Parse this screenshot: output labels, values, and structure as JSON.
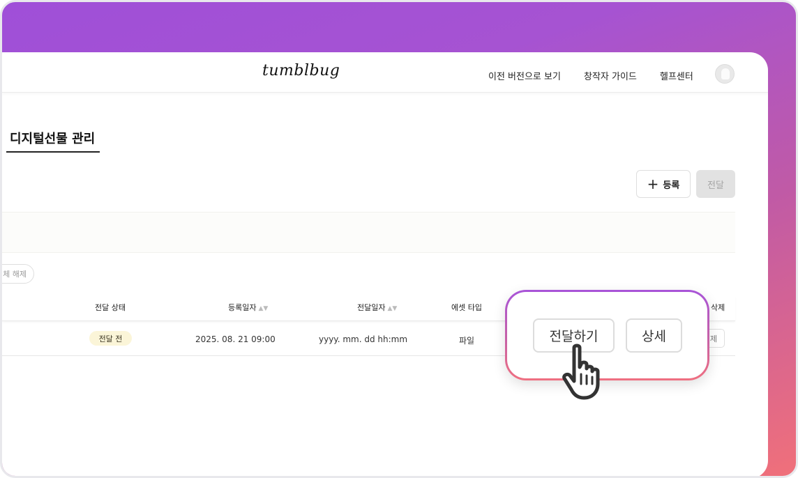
{
  "header": {
    "logo": "tumblbug",
    "nav": {
      "previous_version": "이전 버전으로 보기",
      "creator_guide": "창작자 가이드",
      "help_center": "헬프센터"
    }
  },
  "page": {
    "title": "디지털선물 관리"
  },
  "toolbar": {
    "register_icon": "+",
    "register_label": "등록",
    "deliver_label": "전달"
  },
  "filters": {
    "clear_label": "체 해제"
  },
  "table": {
    "columns": {
      "status": "전달 상태",
      "registered_at": "등록일자",
      "delivered_at": "전달일자",
      "asset_type": "에셋 타입",
      "delete": "삭제"
    },
    "sort_icon": "▲▼",
    "rows": [
      {
        "status": "전달 전",
        "registered_at": "2025. 08. 21 09:00",
        "delivered_at": "yyyy. mm. dd hh:mm",
        "asset_type": "파일",
        "delete_label": "제"
      }
    ]
  },
  "callout": {
    "deliver_label": "전달하기",
    "detail_label": "상세",
    "pointer_icon": "hand-pointer-icon"
  },
  "colors": {
    "gradient_start": "#9f4fd8",
    "gradient_end": "#f0707a",
    "status_badge_bg": "#fbf5d8",
    "disabled_button_bg": "#e2e2e2"
  }
}
